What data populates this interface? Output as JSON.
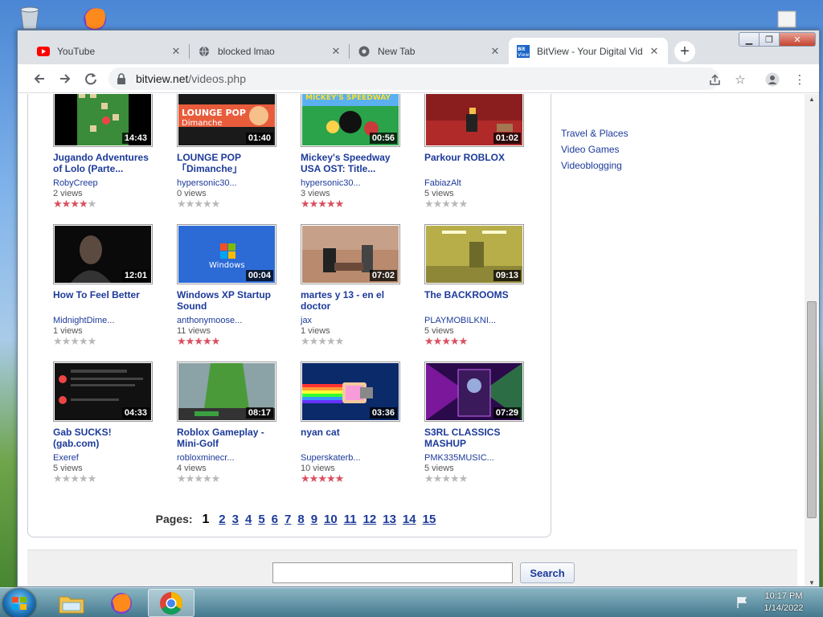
{
  "browser": {
    "tabs": [
      {
        "label": "YouTube",
        "icon": "youtube-icon"
      },
      {
        "label": "blocked lmao",
        "icon": "globe-icon"
      },
      {
        "label": "New Tab",
        "icon": "chrome-icon"
      },
      {
        "label": "BitView - Your Digital Vid",
        "icon": "bitview-icon",
        "active": true
      }
    ],
    "url_host": "bitview.net",
    "url_path": "/videos.php"
  },
  "videos": [
    {
      "title": "Jugando Adventures of Lolo (Parte...",
      "duration": "14:43",
      "user": "RobyCreep",
      "views": "2 views",
      "rating": 4
    },
    {
      "title": "LOUNGE POP 「Dimanche」",
      "duration": "01:40",
      "user": "hypersonic30...",
      "views": "0 views",
      "rating": 0
    },
    {
      "title": "Mickey's Speedway USA OST: Title...",
      "duration": "00:56",
      "user": "hypersonic30...",
      "views": "3 views",
      "rating": 5
    },
    {
      "title": "Parkour ROBLOX",
      "duration": "01:02",
      "user": "FabiazAlt",
      "views": "5 views",
      "rating": 0
    },
    {
      "title": "How To Feel Better",
      "duration": "12:01",
      "user": "MidnightDime...",
      "views": "1 views",
      "rating": 0
    },
    {
      "title": "Windows XP Startup Sound",
      "duration": "00:04",
      "user": "anthonymoose...",
      "views": "11 views",
      "rating": 5
    },
    {
      "title": "martes y 13 - en el doctor",
      "duration": "07:02",
      "user": "jax",
      "views": "1 views",
      "rating": 0
    },
    {
      "title": "The BACKROOMS",
      "duration": "09:13",
      "user": "PLAYMOBILKNI...",
      "views": "5 views",
      "rating": 5
    },
    {
      "title": "Gab SUCKS! (gab.com)",
      "duration": "04:33",
      "user": "Exeref",
      "views": "5 views",
      "rating": 0
    },
    {
      "title": "Roblox Gameplay - Mini-Golf",
      "duration": "08:17",
      "user": "robloxminecr...",
      "views": "4 views",
      "rating": 0
    },
    {
      "title": "nyan cat",
      "duration": "03:36",
      "user": "Superskaterb...",
      "views": "10 views",
      "rating": 5
    },
    {
      "title": "S3RL CLASSICS MASHUP",
      "duration": "07:29",
      "user": "PMK335MUSIC...",
      "views": "5 views",
      "rating": 0
    }
  ],
  "pagination": {
    "label": "Pages:",
    "current": "1",
    "pages": [
      "2",
      "3",
      "4",
      "5",
      "6",
      "7",
      "8",
      "9",
      "10",
      "11",
      "12",
      "13",
      "14",
      "15"
    ]
  },
  "categories": [
    "Travel & Places",
    "Video Games",
    "Videoblogging"
  ],
  "search": {
    "button_label": "Search",
    "value": ""
  },
  "taskbar": {
    "time": "10:17 PM",
    "date": "1/14/2022"
  },
  "colors": {
    "link": "#1c3a9a",
    "star_on": "#d9505f",
    "star_off": "#b9b9b9"
  }
}
